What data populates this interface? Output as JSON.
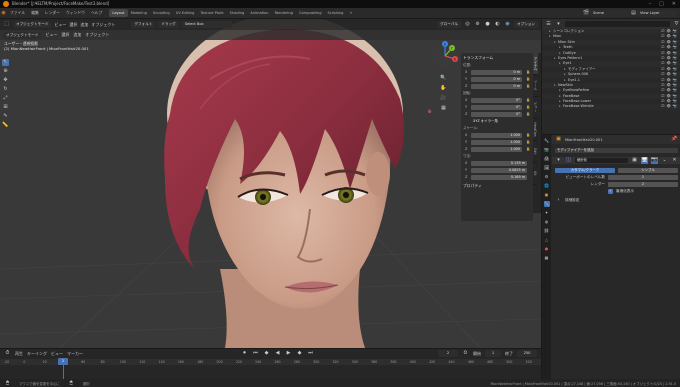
{
  "window": {
    "title": "Blender* [J:¥ELTM/Project/FaceMake/Test3.blend]",
    "controls": [
      "–",
      "□",
      "✕"
    ]
  },
  "menu": {
    "items": [
      "ファイル",
      "編集",
      "レンダー",
      "ウィンドウ",
      "ヘルプ"
    ],
    "workspaces": [
      "Layout",
      "Modeling",
      "Sculpting",
      "UV Editing",
      "Texture Paint",
      "Shading",
      "Animation",
      "Rendering",
      "Compositing",
      "Scripting",
      "+"
    ],
    "active_workspace": "Layout",
    "scene_label": "Scene",
    "view_layer_label": "View Layer"
  },
  "viewport": {
    "header": {
      "mode": "オブジェクトモード",
      "view": "ビュー",
      "select": "選択",
      "add": "追加",
      "object": "オブジェクト",
      "transform_orient": "デフォルト",
      "snap": "ドラッグ",
      "select_box": "Select Box",
      "shading": "グローバル",
      "options": "オプション"
    },
    "info_line1": "ユーザー・透視投影",
    "info_line2": "(2) MionNewHairFront | MionFrontHair20.001",
    "axis_labels": {
      "x": "X",
      "y": "Y",
      "z": "Z"
    }
  },
  "npanel": {
    "title": "トランスフォーム",
    "location_label": "位置:",
    "location": [
      {
        "axis": "X",
        "value": "0 m"
      },
      {
        "axis": "Y",
        "value": "0 m"
      },
      {
        "axis": "Z",
        "value": "0 m"
      }
    ],
    "rotation_label": "回転:",
    "rotation": [
      {
        "axis": "X",
        "value": "0°"
      },
      {
        "axis": "Y",
        "value": "0°"
      },
      {
        "axis": "Z",
        "value": "0°"
      }
    ],
    "rotation_mode": "XYZ オイラー角",
    "scale_label": "スケール:",
    "scale": [
      {
        "axis": "X",
        "value": "1.000"
      },
      {
        "axis": "Y",
        "value": "1.000"
      },
      {
        "axis": "Z",
        "value": "1.000"
      }
    ],
    "dimensions_label": "寸法:",
    "dimensions": [
      {
        "axis": "X",
        "value": "0.139 m"
      },
      {
        "axis": "Y",
        "value": "0.0625 m"
      },
      {
        "axis": "Z",
        "value": "0.169 m"
      }
    ],
    "properties_label": "プロパティ",
    "tabs": [
      "アイテム",
      "ツール",
      "ビュー",
      "HardOps",
      "Edit",
      "Kit"
    ]
  },
  "timeline": {
    "controls": [
      "再生",
      "キーイング",
      "ビュー",
      "マーカー"
    ],
    "current_frame": "2",
    "start_label": "開始",
    "start": "1",
    "end_label": "終了",
    "end": "250",
    "ticks": [
      "-20",
      "0",
      "20",
      "40",
      "60",
      "80",
      "100",
      "120",
      "140",
      "160",
      "180",
      "200",
      "220",
      "240",
      "260",
      "280",
      "300",
      "320",
      "340",
      "360",
      "380",
      "400",
      "420",
      "440",
      "460",
      "480",
      "500",
      "520"
    ],
    "cursor_frame": "2"
  },
  "status": {
    "left": "マウスで値を変更を中心に",
    "mid": "選択",
    "right": "MionNewHairFront | MionFrontHair20.001 | 頂点:27,148 | 面:27,056 | 三角面:54,150 | オブジェクト:0/23 | 2.91.0"
  },
  "outliner": {
    "search_placeholder": "",
    "rows": [
      {
        "label": "シーンコレクション",
        "indent": 1,
        "selected": false
      },
      {
        "label": "Mion",
        "indent": 1,
        "selected": false
      },
      {
        "label": "Mion Skin",
        "indent": 2,
        "selected": false
      },
      {
        "label": "Teeth",
        "indent": 3,
        "selected": false
      },
      {
        "label": "OutEye",
        "indent": 3,
        "selected": false
      },
      {
        "label": "Eyes Pattern1",
        "indent": 2,
        "selected": false
      },
      {
        "label": "Eye1",
        "indent": 3,
        "selected": false
      },
      {
        "label": "モディファイアー",
        "indent": 4,
        "selected": false
      },
      {
        "label": "Sphere.006",
        "indent": 4,
        "selected": false
      },
      {
        "label": "Eye1.1",
        "indent": 4,
        "selected": false
      },
      {
        "label": "NewSkin",
        "indent": 2,
        "selected": false
      },
      {
        "label": "EyeBrowRefine",
        "indent": 3,
        "selected": false
      },
      {
        "label": "FaceBase",
        "indent": 3,
        "selected": false
      },
      {
        "label": "FaceBase.Lower",
        "indent": 3,
        "selected": false
      },
      {
        "label": "FaceBase.Wrinkle",
        "indent": 3,
        "selected": false
      }
    ]
  },
  "properties": {
    "object_name": "MionFrontHair20.001",
    "add_modifier": "モディファイアーを追加",
    "modifier_name": "細分化",
    "tabs": [
      "カタマル/クラーク",
      "シンプル"
    ],
    "active_tab": "カタマル/クラーク",
    "levels_viewport_label": "ビューポートのレベル数",
    "levels_viewport": "1",
    "render_label": "レンダー",
    "render": "2",
    "optimal_display_label": "最適化表示",
    "advanced_label": "詳細設定"
  },
  "colors": {
    "accent": "#4772b3",
    "hair": "#8c2e3f",
    "skin": "#d2ad9b"
  }
}
